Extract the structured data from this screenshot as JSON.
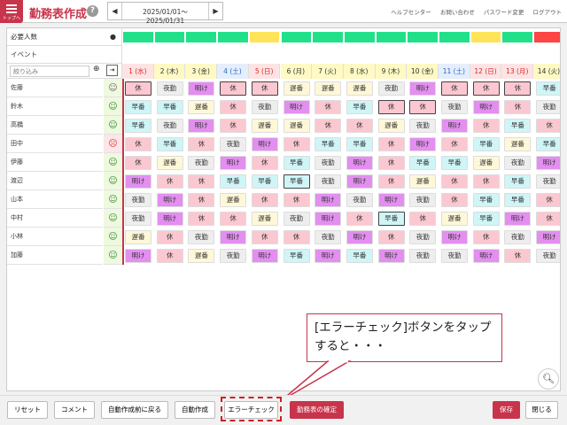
{
  "header": {
    "home_label": "トップへ",
    "title": "勤務表作成",
    "help": "?",
    "date_range": "2025/01/01〜2025/01/31",
    "prev": "◀",
    "next": "▶",
    "links": [
      "ヘルプセンター",
      "お問い合わせ",
      "パスワード変更",
      "ログアウト"
    ]
  },
  "grid": {
    "required_label": "必要人数",
    "event_label": "イベント",
    "filter_placeholder": "絞り込み",
    "required_colors": [
      "#22e08a",
      "#22e08a",
      "#22e08a",
      "#22e08a",
      "#ffe45a",
      "#22e08a",
      "#22e08a",
      "#22e08a",
      "#22e08a",
      "#22e08a",
      "#22e08a",
      "#ffe45a",
      "#22e08a",
      "#ff4444"
    ],
    "days": [
      {
        "label": "1 (水)",
        "type": "sun"
      },
      {
        "label": "2 (木)",
        "type": "wk"
      },
      {
        "label": "3 (金)",
        "type": "wk"
      },
      {
        "label": "4 (土)",
        "type": "sat"
      },
      {
        "label": "5 (日)",
        "type": "sun"
      },
      {
        "label": "6 (月)",
        "type": "wk"
      },
      {
        "label": "7 (火)",
        "type": "wk"
      },
      {
        "label": "8 (水)",
        "type": "wk"
      },
      {
        "label": "9 (木)",
        "type": "wk"
      },
      {
        "label": "10 (金)",
        "type": "wk"
      },
      {
        "label": "11 (土)",
        "type": "sat"
      },
      {
        "label": "12 (日)",
        "type": "sun"
      },
      {
        "label": "13 (月)",
        "type": "sun"
      },
      {
        "label": "14 (火)",
        "type": "wk"
      }
    ],
    "staff": [
      {
        "name": "佐藤",
        "face": "ok",
        "shifts": [
          "休",
          "夜勤",
          "明け",
          "休",
          "休",
          "遅番",
          "遅番",
          "遅番",
          "夜勤",
          "明け",
          "休",
          "休",
          "休",
          "早番"
        ],
        "sel": [
          0,
          3,
          4,
          10,
          11,
          12
        ]
      },
      {
        "name": "鈴木",
        "face": "good",
        "shifts": [
          "早番",
          "早番",
          "遅番",
          "休",
          "夜勤",
          "明け",
          "休",
          "早番",
          "休",
          "休",
          "夜勤",
          "明け",
          "休",
          "夜勤"
        ],
        "sel": [
          8,
          9
        ]
      },
      {
        "name": "高橋",
        "face": "good",
        "shifts": [
          "早番",
          "夜勤",
          "明け",
          "休",
          "遅番",
          "遅番",
          "休",
          "休",
          "遅番",
          "夜勤",
          "明け",
          "休",
          "早番",
          "休"
        ],
        "sel": []
      },
      {
        "name": "田中",
        "face": "bad",
        "shifts": [
          "休",
          "早番",
          "休",
          "夜勤",
          "明け",
          "休",
          "早番",
          "早番",
          "休",
          "明け",
          "休",
          "早番",
          "遅番",
          "早番"
        ],
        "sel": []
      },
      {
        "name": "伊藤",
        "face": "good",
        "shifts": [
          "休",
          "遅番",
          "夜勤",
          "明け",
          "休",
          "早番",
          "夜勤",
          "明け",
          "休",
          "早番",
          "早番",
          "遅番",
          "夜勤",
          "明け"
        ],
        "sel": []
      },
      {
        "name": "渡辺",
        "face": "good",
        "shifts": [
          "明け",
          "休",
          "休",
          "早番",
          "早番",
          "早番",
          "夜勤",
          "明け",
          "休",
          "遅番",
          "休",
          "休",
          "早番",
          "夜勤"
        ],
        "sel": [
          5
        ]
      },
      {
        "name": "山本",
        "face": "good",
        "shifts": [
          "夜勤",
          "明け",
          "休",
          "遅番",
          "休",
          "休",
          "明け",
          "夜勤",
          "明け",
          "夜勤",
          "休",
          "早番",
          "早番",
          "休"
        ],
        "sel": []
      },
      {
        "name": "中村",
        "face": "good",
        "shifts": [
          "夜勤",
          "明け",
          "休",
          "休",
          "遅番",
          "夜勤",
          "明け",
          "休",
          "早番",
          "休",
          "遅番",
          "早番",
          "明け",
          "休"
        ],
        "sel": [
          8
        ]
      },
      {
        "name": "小林",
        "face": "good",
        "shifts": [
          "遅番",
          "休",
          "夜勤",
          "明け",
          "休",
          "休",
          "夜勤",
          "明け",
          "休",
          "夜勤",
          "明け",
          "休",
          "夜勤",
          "明け"
        ],
        "sel": []
      },
      {
        "name": "加藤",
        "face": "good",
        "shifts": [
          "明け",
          "休",
          "遅番",
          "夜勤",
          "明け",
          "早番",
          "明け",
          "早番",
          "明け",
          "夜勤",
          "夜勤",
          "明け",
          "休",
          "夜勤"
        ],
        "sel": []
      }
    ],
    "shift_colors": {
      "休": "#fbc8d1",
      "明け": "#e38ff0",
      "夜勤": "#eeeeee",
      "早番": "#cff5f7",
      "遅番": "#fff8d8"
    }
  },
  "callout": {
    "text": "[エラーチェック]ボタンをタップすると・・・"
  },
  "buttons": {
    "reset": "リセット",
    "comment": "コメント",
    "back": "自動作成前に戻る",
    "auto": "自動作成",
    "errcheck": "エラーチェック",
    "confirm": "勤務表の確定",
    "save": "保存",
    "close": "閉じる"
  }
}
